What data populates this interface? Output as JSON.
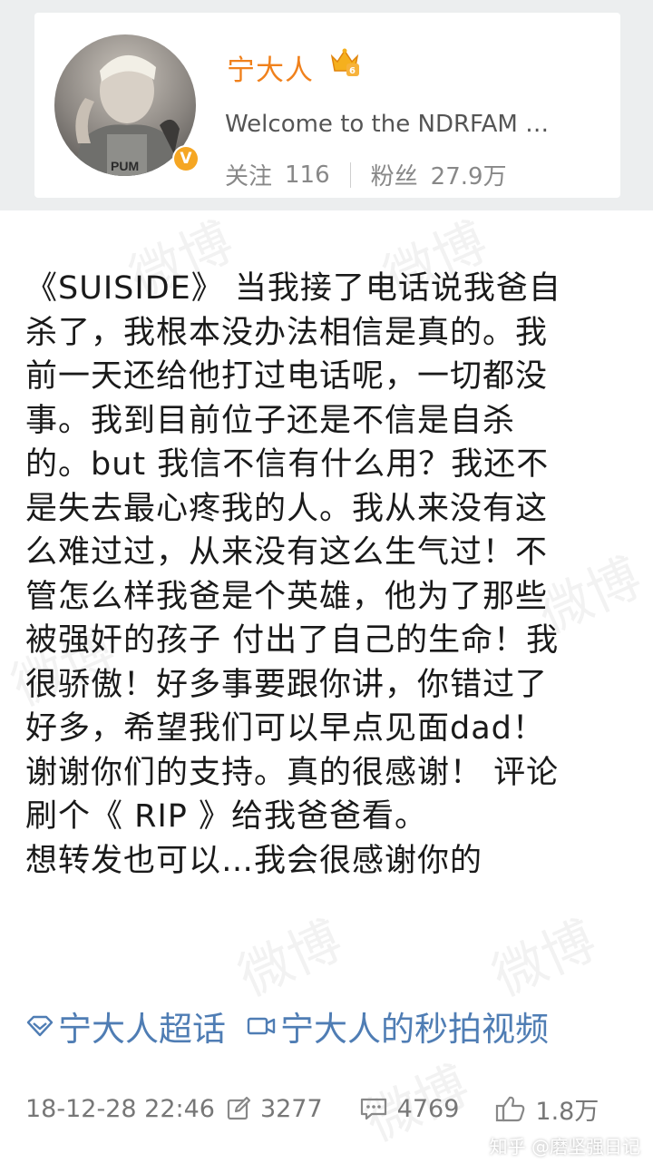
{
  "profile": {
    "username": "宁大人",
    "bio": "Welcome to the NDRFAM …",
    "following_label": "关注",
    "following_count": "116",
    "followers_label": "粉丝",
    "followers_count": "27.9万"
  },
  "post": {
    "lines": [
      "《SUISIDE》 当我接了电话说我爸自",
      "杀了，我根本没办法相信是真的。我",
      "前一天还给他打过电话呢，一切都没",
      "事。我到目前位子还是不信是自杀",
      "的。but 我信不信有什么用？我还不",
      "是失去最心疼我的人。我从来没有这",
      "么难过过，从来没有这么生气过！不",
      "管怎么样我爸是个英雄，他为了那些",
      "被强奸的孩子 付出了自己的生命！我",
      "很骄傲！好多事要跟你讲，你错过了",
      "好多，希望我们可以早点见面dad！",
      "谢谢你们的支持。真的很感谢！ 评论",
      "刷个《 RIP 》给我爸爸看。",
      "想转发也可以…我会很感谢你的"
    ],
    "topics": [
      {
        "label": "宁大人超话",
        "icon": "supertopic-diamond-icon"
      },
      {
        "label": "宁大人的秒拍视频",
        "icon": "video-camera-icon"
      }
    ]
  },
  "footer": {
    "timestamp": "18-12-28 22:46",
    "reposts": "3277",
    "comments": "4769",
    "likes": "1.8万"
  },
  "watermark": "知乎 @磨坚强日记",
  "ghost_watermark": "微博",
  "colors": {
    "username": "#f0811c",
    "link": "#4f7db4",
    "verified": "#f5a623",
    "header_bg": "#eceeef"
  }
}
